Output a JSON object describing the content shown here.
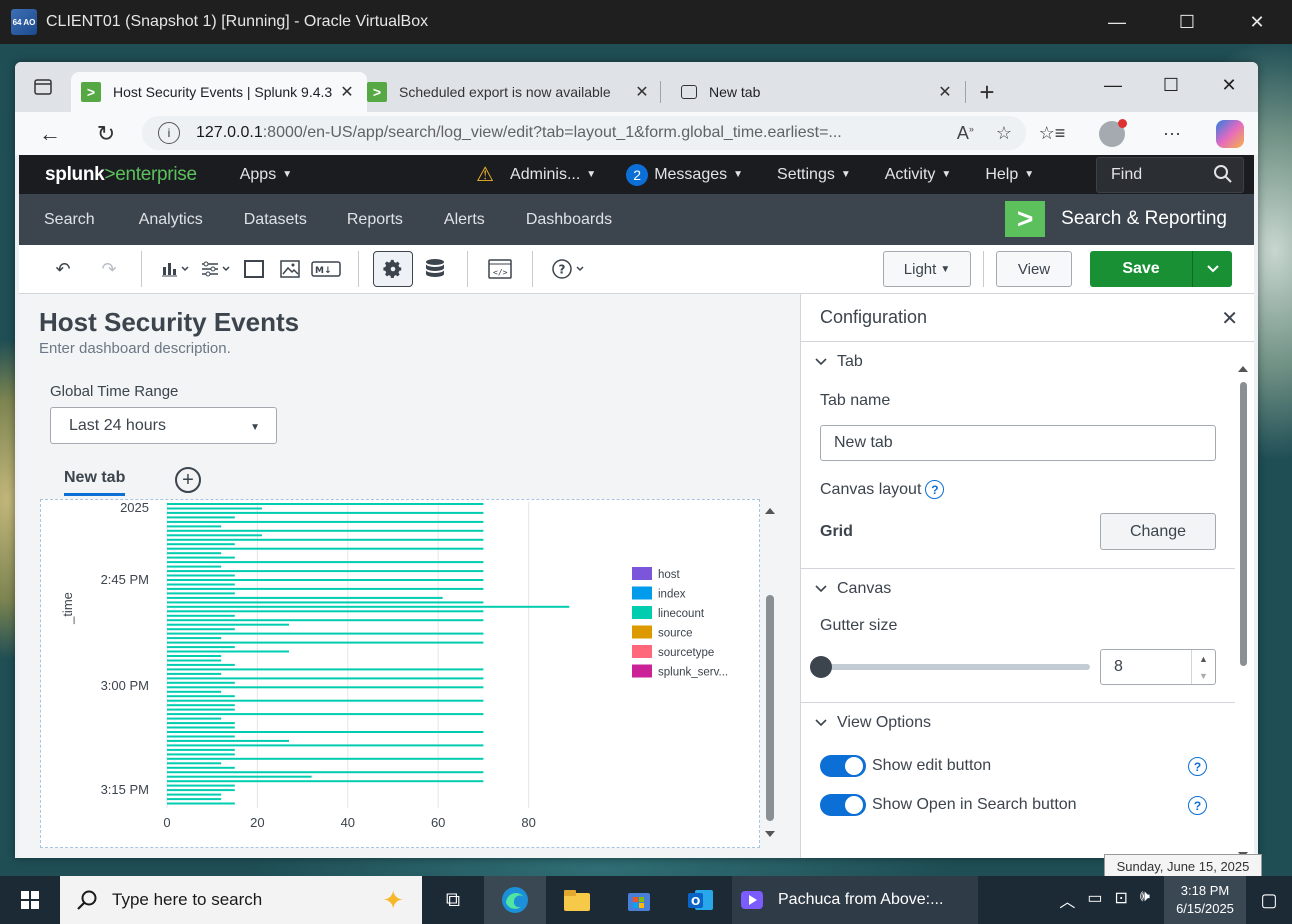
{
  "vbox": {
    "icon_text": "64 AO",
    "title": "CLIENT01 (Snapshot 1) [Running] - Oracle VirtualBox",
    "minimize": "—",
    "maximize": "☐",
    "close": "✕"
  },
  "browser": {
    "tabs": [
      {
        "label": "Host Security Events | Splunk 9.4.3",
        "favicon": ">",
        "close": "✕"
      },
      {
        "label": "Scheduled export is now available",
        "favicon": ">",
        "close": "✕"
      },
      {
        "label": "New tab",
        "close": "✕"
      }
    ],
    "new_tab_plus": "+",
    "url_host": "127.0.0.1",
    "url_path": ":8000/en-US/app/search/log_view/edit?tab=layout_1&form.global_time.earliest=...",
    "back": "←",
    "reload": "↻",
    "winctrl": {
      "minimize": "—",
      "maximize": "☐",
      "close": "✕"
    }
  },
  "splunk": {
    "logo_a": "splunk",
    "logo_b": ">",
    "logo_c": "enterprise",
    "topmenu": {
      "apps": "Apps",
      "admin": "Adminis...",
      "messages_count": "2",
      "messages": "Messages",
      "settings": "Settings",
      "activity": "Activity",
      "help": "Help"
    },
    "find_label": "Find",
    "appnav": [
      "Search",
      "Analytics",
      "Datasets",
      "Reports",
      "Alerts",
      "Dashboards"
    ],
    "app_title": "Search & Reporting",
    "app_logo": ">",
    "toolbar": {
      "light_label": "Light",
      "view_label": "View",
      "save_label": "Save"
    },
    "dashboard": {
      "title": "Host Security Events",
      "description": "Enter dashboard description.",
      "time_label": "Global Time Range",
      "time_value": "Last 24 hours",
      "tab_label": "New tab"
    },
    "config": {
      "header": "Configuration",
      "section_tab": "Tab",
      "tab_name_label": "Tab name",
      "tab_name_value": "New tab",
      "canvas_layout_label": "Canvas layout",
      "canvas_layout_value": "Grid",
      "change_label": "Change",
      "section_canvas": "Canvas",
      "gutter_label": "Gutter size",
      "gutter_value": "8",
      "section_view_options": "View Options",
      "show_edit_label": "Show edit button",
      "show_open_search_label": "Show Open in Search button"
    }
  },
  "chart_data": {
    "type": "bar",
    "orientation": "horizontal",
    "ylabel": "_time",
    "xlabel": "",
    "xlim": [
      0,
      100
    ],
    "x_ticks": [
      "0",
      "20",
      "40",
      "60",
      "80"
    ],
    "y_ticks": [
      "2025",
      "2:45 PM",
      "3:00 PM",
      "3:15 PM"
    ],
    "legend_position": "right",
    "series": [
      {
        "name": "host",
        "color": "#7b56db"
      },
      {
        "name": "index",
        "color": "#009ceb"
      },
      {
        "name": "linecount",
        "color": "#00cdaf"
      },
      {
        "name": "source",
        "color": "#dd9900"
      },
      {
        "name": "sourcetype",
        "color": "#ff677b"
      },
      {
        "name": "splunk_serv...",
        "color": "#cb2196"
      }
    ],
    "linecount_values": [
      70,
      21,
      70,
      15,
      70,
      12,
      70,
      21,
      70,
      15,
      70,
      12,
      15,
      70,
      12,
      70,
      15,
      70,
      15,
      70,
      15,
      61,
      70,
      89,
      70,
      15,
      70,
      27,
      15,
      70,
      12,
      70,
      15,
      27,
      12,
      12,
      15,
      70,
      12,
      70,
      15,
      70,
      12,
      15,
      70,
      15,
      15,
      70,
      12,
      15,
      15,
      70,
      15,
      27,
      70,
      15,
      15,
      70,
      12,
      15,
      70,
      32,
      70,
      15,
      15,
      12,
      12,
      15
    ]
  },
  "taskbar": {
    "search_placeholder": "Type here to search",
    "app_label": "Pachuca from Above:...",
    "time": "3:18 PM",
    "date": "6/15/2025",
    "tooltip": "Sunday, June 15, 2025"
  }
}
